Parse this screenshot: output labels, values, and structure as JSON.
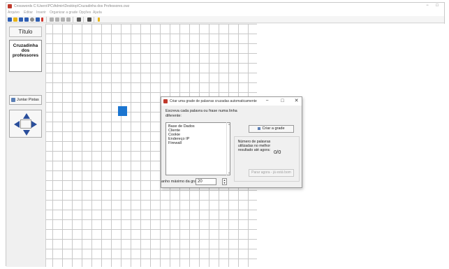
{
  "window": {
    "title": "Crosswords C:\\Users\\PC\\Admin\\Desktop\\Cruzadinha dos Professores.cwz",
    "controls": {
      "minimize": "−",
      "maximize": "□"
    }
  },
  "menubar": {
    "items": [
      {
        "label": "Arquivo"
      },
      {
        "label": "Editar"
      },
      {
        "label": "Inserir"
      },
      {
        "label": "Organizar a grade"
      },
      {
        "label": "Opções"
      },
      {
        "label": "Ajuda"
      }
    ]
  },
  "toolbar": {
    "icons": [
      "new-icon",
      "open-icon",
      "save-icon",
      "save-as-icon",
      "tag-icon",
      "insert-icon",
      "pin-icon",
      "undo-icon",
      "cut-icon",
      "copy-icon",
      "paste-icon",
      "grid-icon",
      "print-icon",
      "help-icon"
    ],
    "colors": {
      "red": "#d0342c",
      "blue": "#2f5fb3",
      "yellow": "#e8b416",
      "gray": "#8c8c8c"
    }
  },
  "sidebar": {
    "title_button": "Título",
    "puzzle_title": [
      "Cruzadinha",
      "dos",
      "professores"
    ],
    "hint_button": "Juntar Pistas"
  },
  "grid": {
    "highlight_color": "#1b75d0"
  },
  "dialog": {
    "title": "Criar uma grade de palavras cruzadas automaticamente",
    "controls": {
      "minimize": "−",
      "maximize": "□",
      "close": "✕"
    },
    "instructions": "Escreva cada palavra ou frase numa linha diferente:",
    "words": "Base de Dados\nCliente\nCookie\nEndereço IP\nFirewall",
    "create_button": "Criar a grade",
    "stats_label": "Número de palavras utilizadas no melhor resultado até agora:",
    "stats_value": "0/0",
    "stop_button": "Parar agora - já está bom",
    "size_label": "anho máximo da grade:",
    "size_value": "20",
    "spinner_up": "▲",
    "spinner_down": "▼"
  }
}
